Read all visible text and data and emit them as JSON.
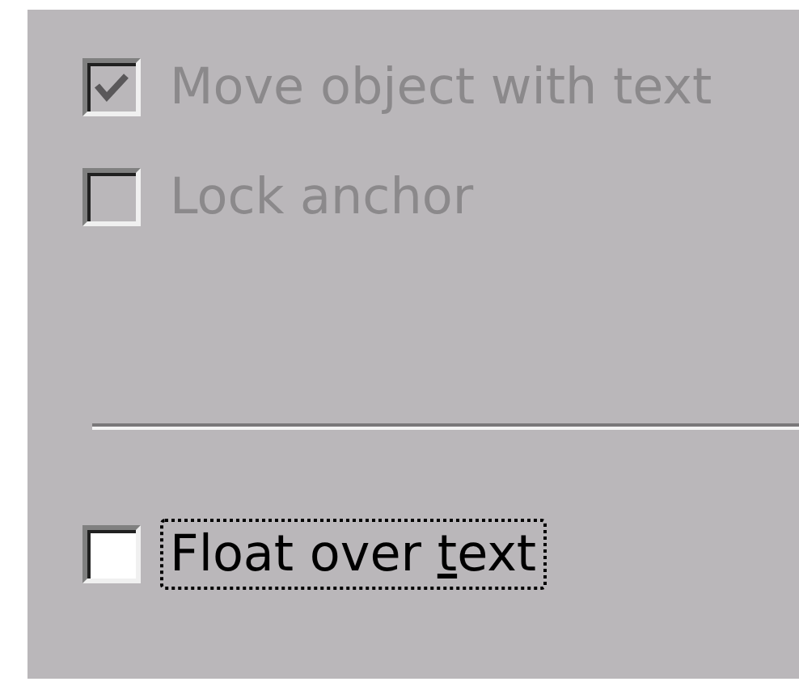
{
  "options_top": [
    {
      "kind": "checkbox",
      "checked": true,
      "disabled": true,
      "focused": false,
      "label": [
        {
          "text": "Move object with text",
          "underline": false
        }
      ]
    },
    {
      "kind": "checkbox",
      "checked": false,
      "disabled": true,
      "focused": false,
      "label": [
        {
          "text": "Lock anchor",
          "underline": false
        }
      ]
    }
  ],
  "options_bottom": [
    {
      "kind": "checkbox",
      "checked": false,
      "disabled": false,
      "focused": true,
      "label": [
        {
          "text": "Float over ",
          "underline": false
        },
        {
          "text": "t",
          "underline": true
        },
        {
          "text": "ext",
          "underline": false
        }
      ]
    }
  ]
}
